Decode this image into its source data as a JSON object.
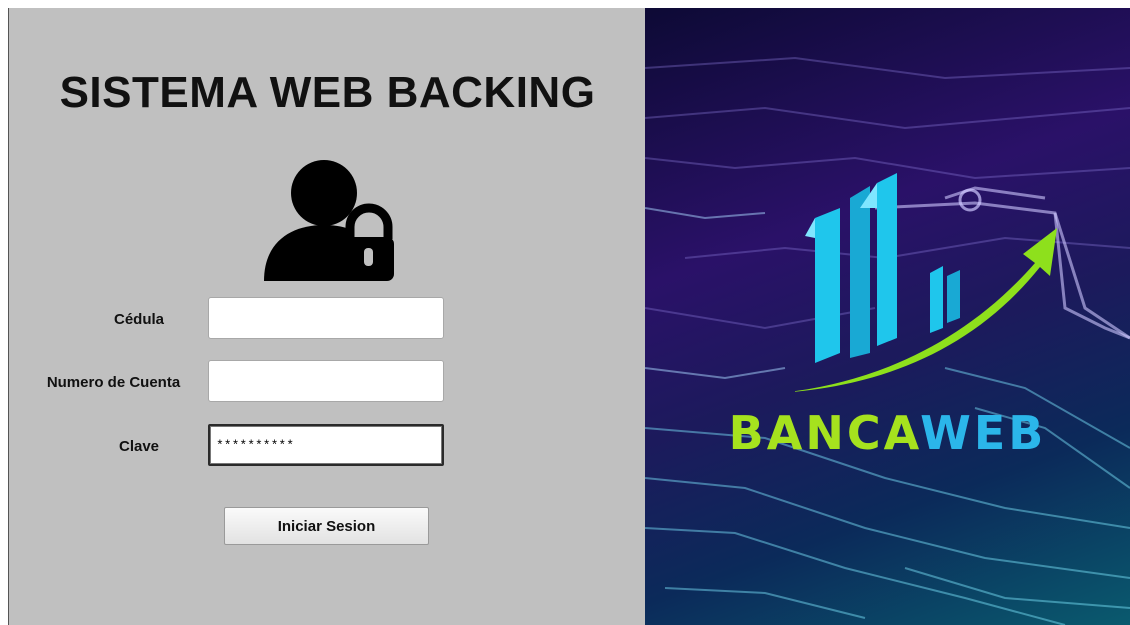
{
  "login": {
    "title": "SISTEMA WEB BACKING",
    "fields": [
      {
        "label": "Cédula",
        "value": ""
      },
      {
        "label": "Numero de Cuenta",
        "value": ""
      },
      {
        "label": "Clave",
        "value": "**********"
      }
    ],
    "submit_label": "Iniciar Sesion"
  },
  "brand": {
    "name_part_1": "BANCA",
    "name_part_2": "WEB",
    "color_part_1": "#a6e21e",
    "color_part_2": "#2bb6ea"
  },
  "icons": {
    "user_lock": "user-lock-icon",
    "logo": "bancaweb-logo-icon"
  },
  "colors": {
    "panel_background": "#c0c0c0",
    "arrow": "#8ee01c",
    "buildings": "#1fc6ec"
  }
}
